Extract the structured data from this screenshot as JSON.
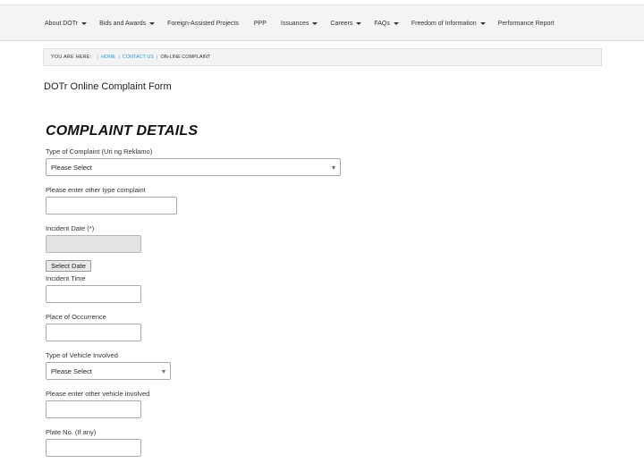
{
  "nav": {
    "items": [
      {
        "label": "About DOTr",
        "dropdown": true
      },
      {
        "label": "Bids and Awards",
        "dropdown": true
      },
      {
        "label": "Foreign-Assisted Projects",
        "dropdown": false
      },
      {
        "label": "PPP",
        "dropdown": false
      },
      {
        "label": "Issuances",
        "dropdown": true
      },
      {
        "label": "Careers",
        "dropdown": true
      },
      {
        "label": "FAQs",
        "dropdown": true
      },
      {
        "label": "Freedom of Information",
        "dropdown": true
      },
      {
        "label": "Performance Report",
        "dropdown": false
      }
    ]
  },
  "breadcrumb": {
    "label": "YOU ARE HERE:",
    "home": "HOME",
    "contact": "CONTACT US",
    "current": "ON-LINE COMPLAINT"
  },
  "page": {
    "title": "DOTr Online Complaint Form",
    "section_title": "COMPLAINT DETAILS"
  },
  "form": {
    "complaint_type_label": "Type of Complaint (Uri ng Reklamo)",
    "complaint_type_value": "Please Select",
    "other_complaint_label": "Please enter other type complaint",
    "incident_date_label": "Incident Date (*)",
    "select_date_button": "Select Date",
    "incident_time_label": "Incident Time",
    "place_label": "Place of Occurrence",
    "vehicle_type_label": "Type of Vehicle Involved",
    "vehicle_type_value": "Please Select",
    "other_vehicle_label": "Please enter other vehicle involved",
    "plate_label": "Plate No. (If any)"
  },
  "colors": {
    "link": "#2a9fd6",
    "navbar_bg": "#f4f4f4",
    "disabled_input": "#e3e3e3"
  }
}
